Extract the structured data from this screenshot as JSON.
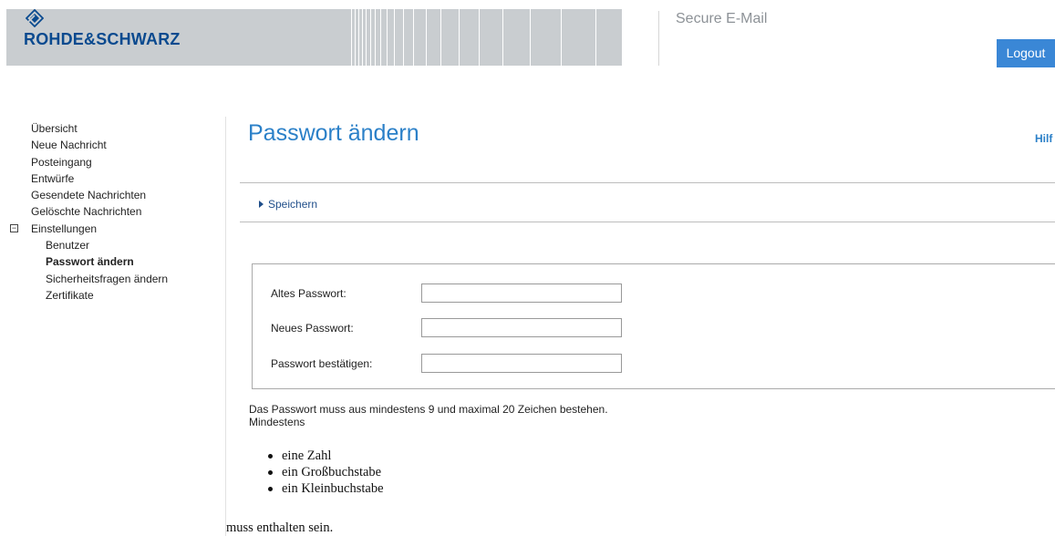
{
  "header": {
    "brand": "ROHDE&SCHWARZ",
    "logo_icon": "rohde-schwarz-diamond-logo",
    "app_title": "Secure E-Mail",
    "logout_label": "Logout"
  },
  "sidebar": {
    "items": [
      {
        "label": "Übersicht"
      },
      {
        "label": "Neue Nachricht"
      },
      {
        "label": "Posteingang"
      },
      {
        "label": "Entwürfe"
      },
      {
        "label": "Gesendete Nachrichten"
      },
      {
        "label": "Gelöschte Nachrichten"
      }
    ],
    "group": {
      "label": "Einstellungen",
      "toggle_symbol": "−",
      "expanded": true,
      "children": [
        {
          "label": "Benutzer"
        },
        {
          "label": "Passwort ändern",
          "active": true
        },
        {
          "label": "Sicherheitsfragen ändern"
        },
        {
          "label": "Zertifikate"
        }
      ]
    }
  },
  "main": {
    "title": "Passwort ändern",
    "help_label": "Hilf",
    "save_label": "Speichern",
    "form": {
      "old_password_label": "Altes Passwort:",
      "new_password_label": "Neues Passwort:",
      "confirm_password_label": "Passwort bestätigen:",
      "old_password_value": "",
      "new_password_value": "",
      "confirm_password_value": ""
    },
    "rules_line1": "Das Passwort muss aus mindestens 9 und maximal 20 Zeichen bestehen.",
    "rules_line2": "Mindestens",
    "requirements": [
      "eine Zahl",
      "ein Großbuchstabe",
      "ein Kleinbuchstabe"
    ],
    "footer_text": "muss enthalten sein."
  },
  "colors": {
    "accent": "#2b80c8",
    "logout_bg": "#3a87d6",
    "brand_bar": "#c9cdd0",
    "brand_text": "#0a4a8f"
  }
}
